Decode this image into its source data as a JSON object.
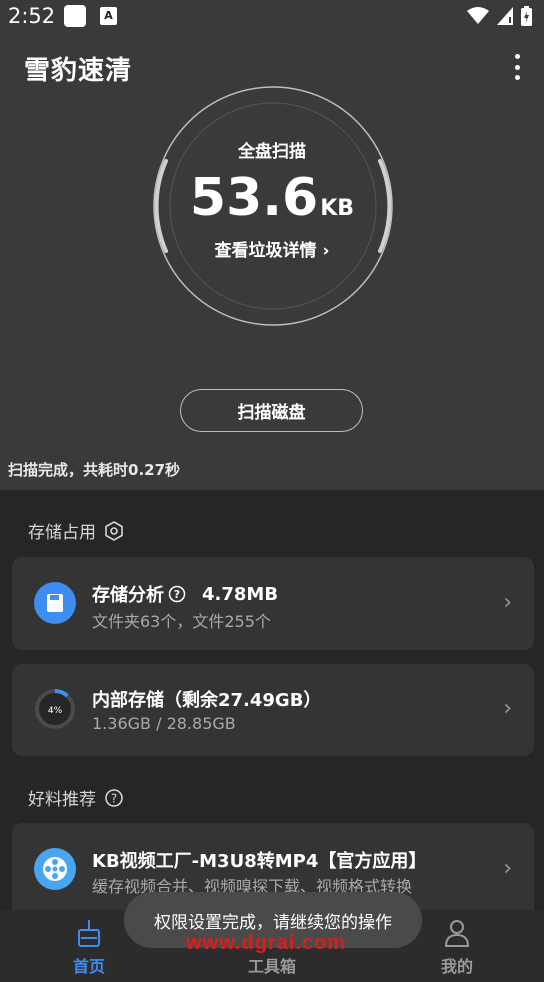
{
  "status_bar": {
    "time": "2:52",
    "a_icon": "A"
  },
  "header": {
    "title": "雪豹速清",
    "more_icon": "more-vert-icon"
  },
  "scan_ring": {
    "title": "全盘扫描",
    "value": "53.6",
    "unit": "KB",
    "link": "查看垃圾详情"
  },
  "scan_button": "扫描磁盘",
  "scan_status": "扫描完成，共耗时0.27秒",
  "storage_section": {
    "title": "存储占用"
  },
  "storage_analysis": {
    "title": "存储分析",
    "size": "4.78MB",
    "subtitle": "文件夹63个，文件255个"
  },
  "internal_storage": {
    "title": "内部存储（剩余27.49GB）",
    "subtitle": "1.36GB / 28.85GB",
    "percent_label": "4%",
    "percent": 4
  },
  "recommend_section": {
    "title": "好料推荐"
  },
  "recommend_item": {
    "title": "KB视频工厂-M3U8转MP4【官方应用】",
    "subtitle": "缓存视频合并、视频嗅探下载、视频格式转换"
  },
  "tabs": [
    {
      "label": "首页",
      "icon": "broom-icon",
      "active": true
    },
    {
      "label": "工具箱",
      "icon": "toolbox-icon",
      "active": false
    },
    {
      "label": "我的",
      "icon": "person-icon",
      "active": false
    }
  ],
  "toast": "权限设置完成，请继续您的操作",
  "watermark": "www.dgrai.com",
  "colors": {
    "accent": "#3d8ef0",
    "background": "#3a3a3a",
    "panel": "#262626",
    "card": "#343434",
    "watermark": "#d81e1e"
  }
}
